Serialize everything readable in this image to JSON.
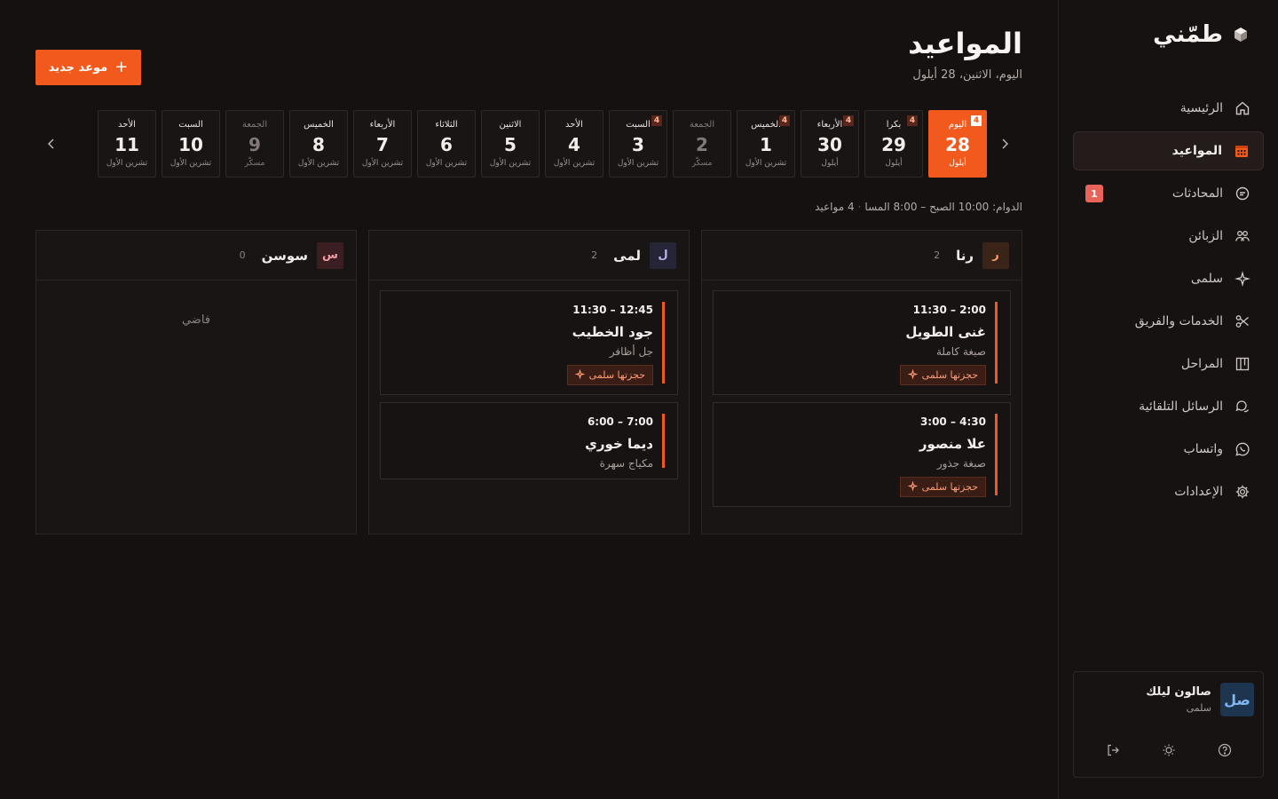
{
  "brand": {
    "name": "طمّني"
  },
  "nav": {
    "items": [
      {
        "label": "الرئيسية",
        "icon": "home-icon"
      },
      {
        "label": "المواعيد",
        "icon": "calendar-icon",
        "active": true
      },
      {
        "label": "المحادثات",
        "icon": "chat-icon",
        "badge": "1"
      },
      {
        "label": "الزبائن",
        "icon": "users-icon"
      },
      {
        "label": "سلمى",
        "icon": "sparkle-icon"
      },
      {
        "label": "الخدمات والفريق",
        "icon": "scissors-icon"
      },
      {
        "label": "المراحل",
        "icon": "kanban-icon"
      },
      {
        "label": "الرسائل التلقائية",
        "icon": "messages-icon"
      },
      {
        "label": "واتساب",
        "icon": "whatsapp-icon"
      },
      {
        "label": "الإعدادات",
        "icon": "gear-icon"
      }
    ]
  },
  "org": {
    "avatar": "صل",
    "name": "صالون ليلك",
    "user": "سلمى"
  },
  "header": {
    "title": "المواعيد",
    "subtitle": "اليوم، الاثنين، 28 أيلول",
    "new_button": "موعد جديد"
  },
  "days": [
    {
      "name": "اليوم",
      "num": "28",
      "month": "أيلول",
      "count": "4",
      "today": true
    },
    {
      "name": "بكرا",
      "num": "29",
      "month": "أيلول",
      "count": "4"
    },
    {
      "name": "الأربعاء",
      "num": "30",
      "month": "أيلول",
      "count": "4"
    },
    {
      "name": "الخميس",
      "num": "1",
      "month": "تشرين الأول",
      "count": "4"
    },
    {
      "name": "الجمعة",
      "num": "2",
      "month": "مسكّر",
      "off": true
    },
    {
      "name": "السبت",
      "num": "3",
      "month": "تشرين الأول",
      "count": "4"
    },
    {
      "name": "الأحد",
      "num": "4",
      "month": "تشرين الأول"
    },
    {
      "name": "الاثنين",
      "num": "5",
      "month": "تشرين الأول"
    },
    {
      "name": "الثلاثاء",
      "num": "6",
      "month": "تشرين الأول"
    },
    {
      "name": "الأربعاء",
      "num": "7",
      "month": "تشرين الأول"
    },
    {
      "name": "الخميس",
      "num": "8",
      "month": "تشرين الأول"
    },
    {
      "name": "الجمعة",
      "num": "9",
      "month": "مسكّر",
      "off": true
    },
    {
      "name": "السبت",
      "num": "10",
      "month": "تشرين الأول"
    },
    {
      "name": "الأحد",
      "num": "11",
      "month": "تشرين الأول"
    }
  ],
  "hours": {
    "text": "الدوام: 10:00 الصبح – 8:00 المسا",
    "count": "4 مواعيد"
  },
  "staff": [
    {
      "initial": "ر",
      "name": "رنا",
      "count": "2",
      "avatar_bg": "#3a2418",
      "avatar_fg": "#ff9c6a",
      "appointments": [
        {
          "time": "11:30 – 2:00",
          "client": "غنى الطويل",
          "service": "صبغة كاملة",
          "tag": "حجزتها سلمى"
        },
        {
          "time": "3:00 – 4:30",
          "client": "علا منصور",
          "service": "صبغة جذور",
          "tag": "حجزتها سلمى"
        }
      ]
    },
    {
      "initial": "ل",
      "name": "لمى",
      "count": "2",
      "avatar_bg": "#262538",
      "avatar_fg": "#b9b4ef",
      "appointments": [
        {
          "time": "11:30 – 12:45",
          "client": "جود الخطيب",
          "service": "جل أظافر",
          "tag": "حجزتها سلمى"
        },
        {
          "time": "6:00 – 7:00",
          "client": "ديما خوري",
          "service": "مكياج سهرة"
        }
      ]
    },
    {
      "initial": "س",
      "name": "سوسن",
      "count": "0",
      "avatar_bg": "#3a1e22",
      "avatar_fg": "#f19aa4",
      "empty": "فاضي",
      "appointments": []
    }
  ],
  "colors": {
    "accent": "#f15a1c",
    "background": "#151111",
    "badge": "#e8645a"
  }
}
